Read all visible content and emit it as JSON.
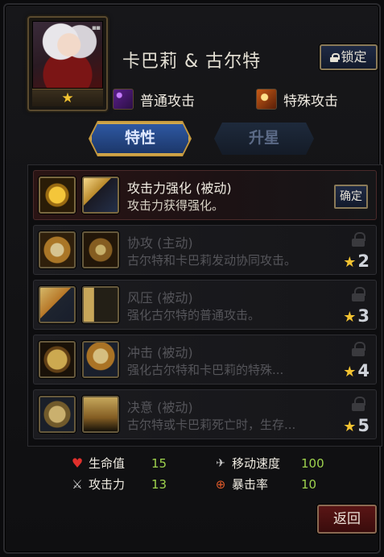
{
  "character": {
    "name": "卡巴莉 & 古尔特",
    "star_glyph": "★",
    "dots_glyph": "▪▪"
  },
  "lock_button": {
    "label": "锁定",
    "icon": "lock-icon"
  },
  "attack_types": [
    {
      "label": "普通攻击",
      "icon": "normal-attack-icon"
    },
    {
      "label": "特殊攻击",
      "icon": "special-attack-icon"
    }
  ],
  "tabs": [
    {
      "label": "特性",
      "active": true
    },
    {
      "label": "升星",
      "active": false
    }
  ],
  "skills": [
    {
      "title": "攻击力强化 (被动)",
      "desc": "攻击力获得强化。",
      "status": "unlocked",
      "button": "确定"
    },
    {
      "title": "协攻 (主动)",
      "desc": "古尔特和卡巴莉发动协同攻击。",
      "status": "locked",
      "req_star": "★",
      "req_num": "2"
    },
    {
      "title": "风压 (被动)",
      "desc": "强化古尔特的普通攻击。",
      "status": "locked",
      "req_star": "★",
      "req_num": "3"
    },
    {
      "title": "冲击 (被动)",
      "desc": "强化古尔特和卡巴莉的特殊...",
      "status": "locked",
      "req_star": "★",
      "req_num": "4"
    },
    {
      "title": "决意 (被动)",
      "desc": "古尔特或卡巴莉死亡时，生存...",
      "status": "locked",
      "req_star": "★",
      "req_num": "5"
    }
  ],
  "stats": {
    "hp": {
      "label": "生命值",
      "value": "15",
      "icon": "heart-icon"
    },
    "atk": {
      "label": "攻击力",
      "value": "13",
      "icon": "sword-icon"
    },
    "speed": {
      "label": "移动速度",
      "value": "100",
      "icon": "boot-icon"
    },
    "crit": {
      "label": "暴击率",
      "value": "10",
      "icon": "crosshair-icon"
    }
  },
  "return_button": {
    "label": "返回"
  },
  "colors": {
    "accent_gold": "#f3c331",
    "stat_value": "#9ed24d",
    "tab_active": "#2f5aa6"
  }
}
